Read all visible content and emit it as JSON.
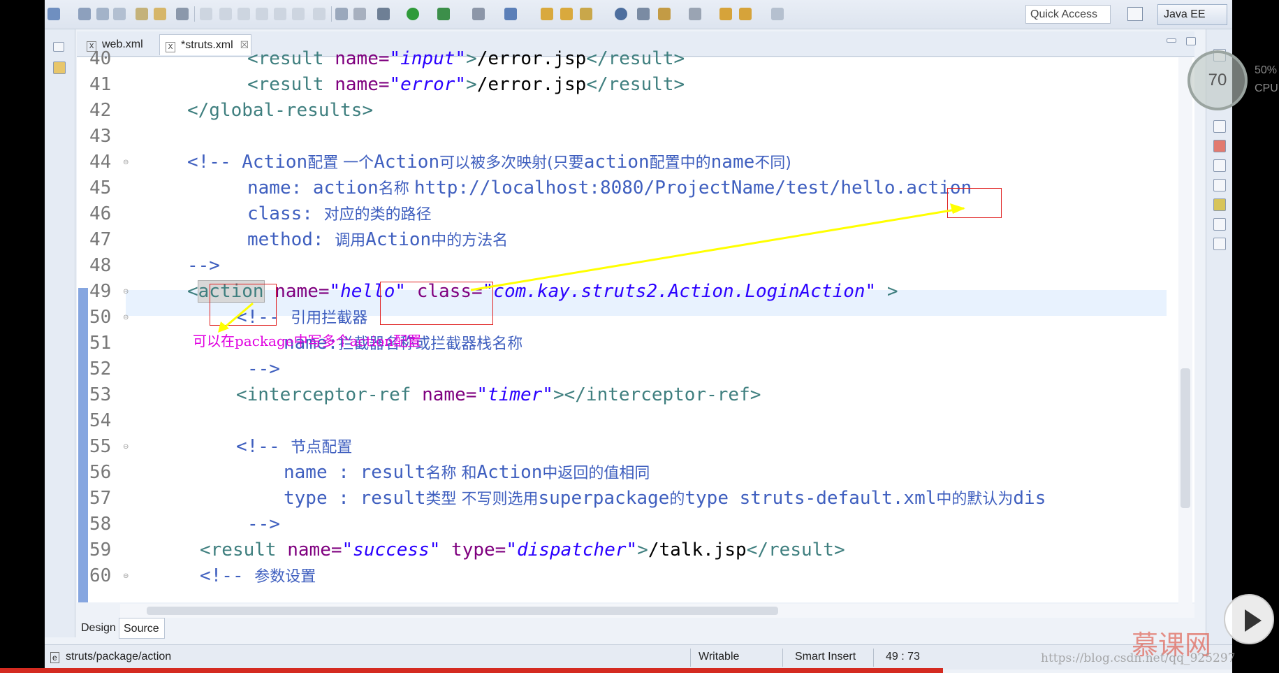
{
  "toolbar": {
    "quick_access": "Quick Access",
    "perspective": "Java EE"
  },
  "tabs": [
    {
      "label": "web.xml",
      "active": false,
      "icon": "X"
    },
    {
      "label": "*struts.xml",
      "active": true,
      "icon": "X",
      "close": "☒"
    }
  ],
  "editor": {
    "current_line": 49,
    "lines": [
      {
        "n": "40"
      },
      {
        "n": "41"
      },
      {
        "n": "42"
      },
      {
        "n": "43"
      },
      {
        "n": "44"
      },
      {
        "n": "45"
      },
      {
        "n": "46"
      },
      {
        "n": "47"
      },
      {
        "n": "48"
      },
      {
        "n": "49"
      },
      {
        "n": "50"
      },
      {
        "n": "51"
      },
      {
        "n": "52"
      },
      {
        "n": "53"
      },
      {
        "n": "54"
      },
      {
        "n": "55"
      },
      {
        "n": "56"
      },
      {
        "n": "57"
      },
      {
        "n": "58"
      },
      {
        "n": "59"
      },
      {
        "n": "60"
      }
    ],
    "code": {
      "l40_a": "<result ",
      "l40_b": "name=",
      "l40_c": "\"input\"",
      "l40_d": ">",
      "l40_e": "/error.jsp",
      "l40_f": "</result>",
      "l41_a": "<result ",
      "l41_b": "name=",
      "l41_c": "\"error\"",
      "l41_d": ">",
      "l41_e": "/error.jsp",
      "l41_f": "</result>",
      "l42": "</global-results>",
      "l44_a": "<!-- Action",
      "l44_b": "配置 一个",
      "l44_c": "Action",
      "l44_d": "可以被多次映射(只要",
      "l44_e": "action",
      "l44_f": "配置中的",
      "l44_g": "name",
      "l44_h": "不同)",
      "l45_a": "name: action",
      "l45_b": "名称 ",
      "l45_c": "http://localhost:8080/ProjectName/test/hello.action",
      "l46_a": "class: ",
      "l46_b": "对应的类的路径",
      "l47_a": "method: ",
      "l47_b": "调用",
      "l47_c": "Action",
      "l47_d": "中的方法名",
      "l48": "-->",
      "l49_a": "<",
      "l49_b": "action",
      "l49_c": " name=",
      "l49_d": "\"hello\"",
      "l49_e": " class=",
      "l49_f": "\"com.kay.struts2.Action.LoginAction\"",
      "l49_g": " >",
      "l50_a": "<!-- ",
      "l50_b": "引用拦截器",
      "l51_a": "name:",
      "l51_b": "拦截器名称或拦截器栈名称",
      "l52": "-->",
      "l53_a": "<interceptor-ref ",
      "l53_b": "name=",
      "l53_c": "\"timer\"",
      "l53_d": "></interceptor-ref>",
      "l55_a": "<!-- ",
      "l55_b": "节点配置",
      "l56_a": "name : result",
      "l56_b": "名称 和",
      "l56_c": "Action",
      "l56_d": "中返回的值相同",
      "l57_a": "type : result",
      "l57_b": "类型 不写则选用",
      "l57_c": "superpackage",
      "l57_d": "的",
      "l57_e": "type struts-default.xml",
      "l57_f": "中的默认为",
      "l57_g": "dis",
      "l58": "-->",
      "l59_a": "<result ",
      "l59_b": "name=",
      "l59_c": "\"success\"",
      "l59_d": " type=",
      "l59_e": "\"dispatcher\"",
      "l59_f": ">",
      "l59_g": "/talk.jsp",
      "l59_h": "</result>",
      "l60_a": "<!-- ",
      "l60_b": "参数设置"
    }
  },
  "annotation": {
    "note": "可以在package中写多个action配置"
  },
  "mode_tabs": [
    {
      "label": "Design",
      "active": false
    },
    {
      "label": "Source",
      "active": true
    }
  ],
  "status": {
    "path": "struts/package/action",
    "writable": "Writable",
    "insert_mode": "Smart Insert",
    "position": "49 : 73"
  },
  "overlay": {
    "cpu_percent": "70",
    "cpu_label_pct": "50%",
    "cpu_label": "CPU",
    "watermark": "https://blog.csdn.net/qq_",
    "watermark_tail": "925297",
    "brand": "慕课网"
  },
  "colors": {
    "tag": "#3f7f7f",
    "attribute": "#7f007f",
    "string": "#2a00ff",
    "comment": "#3f5fbf",
    "annotation_box": "#e02020",
    "annotation_text": "#e000e0",
    "arrow": "#ffff00"
  }
}
